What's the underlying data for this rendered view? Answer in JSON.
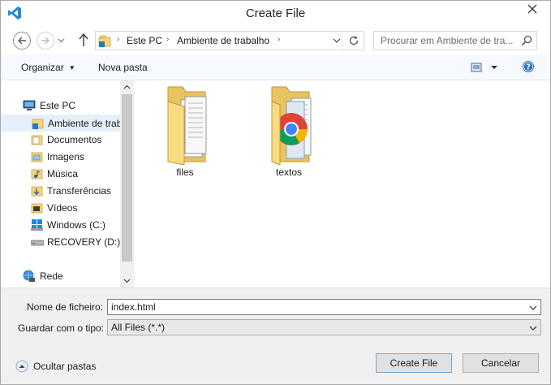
{
  "window": {
    "title": "Create File"
  },
  "address": {
    "crumbs": [
      "Este PC",
      "Ambiente de trabalho"
    ],
    "search_placeholder": "Procurar em Ambiente de tra..."
  },
  "toolbar": {
    "organize_label": "Organizar",
    "new_folder_label": "Nova pasta"
  },
  "nav": {
    "this_pc": "Este PC",
    "items": [
      {
        "label": "Ambiente de trabalho",
        "icon": "desktop-folder-icon",
        "selected": true
      },
      {
        "label": "Documentos",
        "icon": "documents-folder-icon"
      },
      {
        "label": "Imagens",
        "icon": "pictures-folder-icon"
      },
      {
        "label": "Música",
        "icon": "music-folder-icon"
      },
      {
        "label": "Transferências",
        "icon": "downloads-folder-icon"
      },
      {
        "label": "Vídeos",
        "icon": "videos-folder-icon"
      },
      {
        "label": "Windows (C:)",
        "icon": "windows-drive-icon"
      },
      {
        "label": "RECOVERY (D:)",
        "icon": "drive-icon"
      }
    ],
    "network": "Rede"
  },
  "files": [
    {
      "name": "files",
      "icon": "folder-documents-icon"
    },
    {
      "name": "textos",
      "icon": "folder-chrome-icon"
    }
  ],
  "form": {
    "filename_label": "Nome de ficheiro:",
    "filename_value": "index.html",
    "type_label": "Guardar com o tipo:",
    "type_value": "All Files (*.*)"
  },
  "footer": {
    "hide_folders_label": "Ocultar pastas",
    "create_label": "Create File",
    "cancel_label": "Cancelar"
  },
  "colors": {
    "accent": "#0078d7",
    "selection": "#e5f0fb",
    "folder": "#f5d67b"
  }
}
